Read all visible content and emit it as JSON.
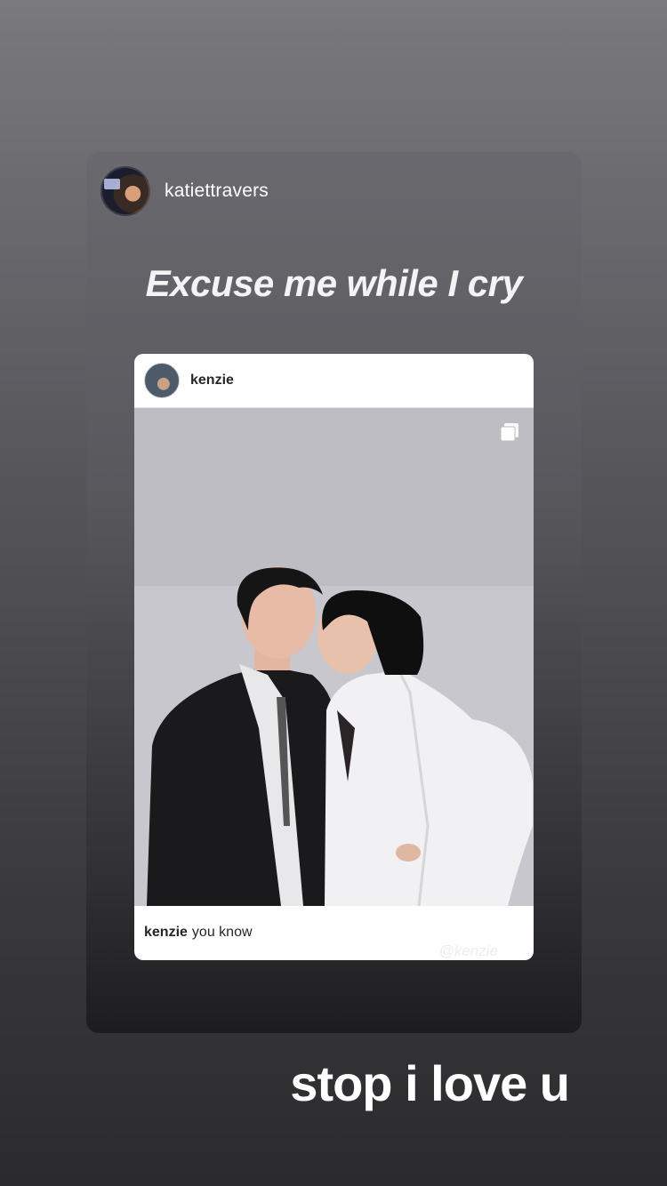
{
  "story": {
    "reposter_username": "katiettravers",
    "headline": "Excuse me while I cry",
    "bottom_text": "stop i love u"
  },
  "post": {
    "username": "kenzie",
    "caption_user": "kenzie",
    "caption_text": "you know",
    "watermark": "@kenzie",
    "multi_icon": "carousel-icon"
  },
  "colors": {
    "background_top": "#7a797e",
    "background_bottom": "#2b2a2d",
    "card_background": "#ffffff",
    "text_primary": "#262626"
  }
}
